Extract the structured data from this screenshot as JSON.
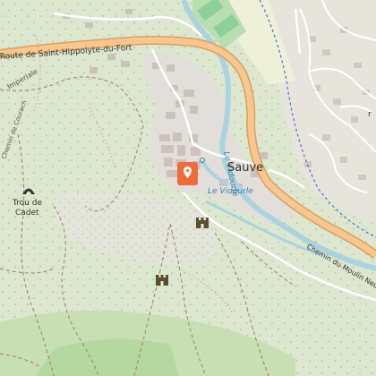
{
  "map": {
    "labels": {
      "road_main": "Route de Saint-Hippolyte-du-Fort",
      "road_imperiale": "Imperiale",
      "chemin_courach": "Chemin de Courach",
      "river_vidourle_1": "Le Vidourle",
      "river_vidourle_2": "Le Vidourle",
      "town": "Sauve",
      "cave_name_1": "Trou de",
      "cave_name_2": "Cadet",
      "chemin_moulin": "Chemin du Moulin Neuf",
      "edge_letter": "r"
    },
    "markers": [
      {
        "name": "location-pin",
        "icon": "map-pin-icon",
        "color": "#ef6b3a"
      },
      {
        "name": "castle-1",
        "icon": "castle-icon"
      },
      {
        "name": "castle-2",
        "icon": "castle-icon"
      },
      {
        "name": "cave",
        "icon": "cave-icon"
      }
    ],
    "colors": {
      "forest": "#dbe6cc",
      "scrub": "#cfe0b8",
      "grass": "#b9dca7",
      "urban": "#e0ddd9",
      "road_fill": "#f7c78f",
      "road_casing": "#d99f5f",
      "river": "#aad3df",
      "building": "#c9c0b8",
      "railway_dash": "#4a6bd8",
      "pin": "#ef6b3a"
    }
  }
}
